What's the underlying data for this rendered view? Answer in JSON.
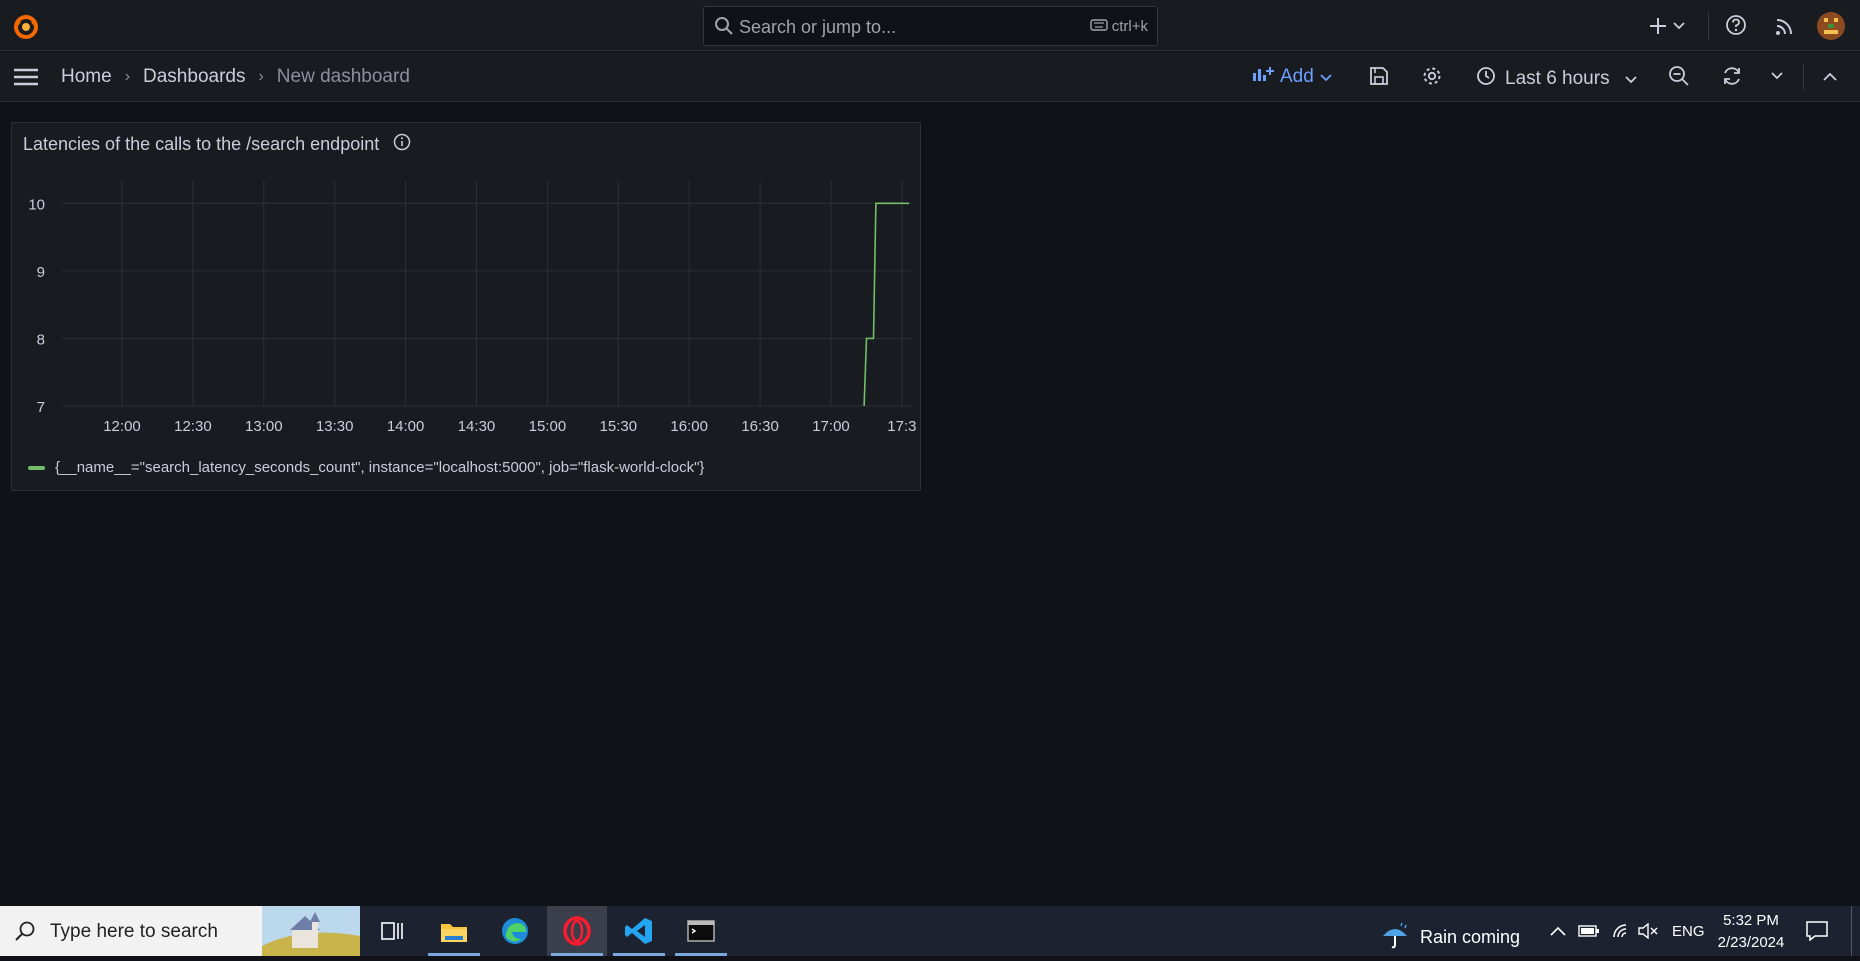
{
  "search": {
    "placeholder": "Search or jump to...",
    "shortcut": "ctrl+k"
  },
  "breadcrumb": {
    "home": "Home",
    "dashboards": "Dashboards",
    "current": "New dashboard"
  },
  "toolbar": {
    "add_label": "Add",
    "time_range": "Last 6 hours"
  },
  "panel": {
    "title": "Latencies of the calls to the /search endpoint",
    "legend": "{__name__=\"search_latency_seconds_count\", instance=\"localhost:5000\", job=\"flask-world-clock\"}",
    "series_color": "#73bf69"
  },
  "chart_data": {
    "type": "line",
    "title": "Latencies of the calls to the /search endpoint",
    "xlabel": "",
    "ylabel": "",
    "x_ticks": [
      "12:00",
      "12:30",
      "13:00",
      "13:30",
      "14:00",
      "14:30",
      "15:00",
      "15:30",
      "16:00",
      "16:30",
      "17:00",
      "17:3"
    ],
    "y_ticks": [
      7,
      8,
      9,
      10
    ],
    "ylim": [
      7,
      10.3
    ],
    "grid": true,
    "legend_position": "bottom-left",
    "series": [
      {
        "name": "{__name__=\"search_latency_seconds_count\", instance=\"localhost:5000\", job=\"flask-world-clock\"}",
        "points": [
          {
            "x": "17:14",
            "y": 7
          },
          {
            "x": "17:15",
            "y": 8
          },
          {
            "x": "17:18",
            "y": 8
          },
          {
            "x": "17:19",
            "y": 10
          },
          {
            "x": "17:33",
            "y": 10
          }
        ]
      }
    ]
  },
  "taskbar": {
    "search_placeholder": "Type here to search",
    "weather": "Rain coming",
    "language": "ENG",
    "time": "5:32 PM",
    "date": "2/23/2024"
  }
}
